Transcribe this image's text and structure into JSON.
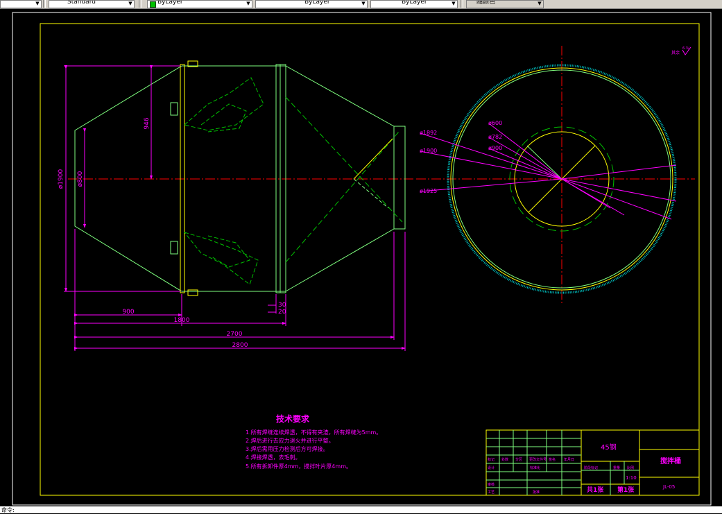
{
  "toolbar": {
    "style_value": "Standard",
    "color_value": "ByLayer",
    "linetype_value": "ByLayer",
    "lineweight_value": "ByLayer",
    "plotstyle_value": "随颜色"
  },
  "drawing": {
    "dims_front": {
      "d1900": "ø1900",
      "d800": "ø800",
      "h946": "946",
      "w900": "900",
      "w1800": "1800",
      "w2700": "2700",
      "w2800": "2800",
      "t30": "30",
      "t20": "20"
    },
    "dims_side": {
      "d600": "ø600",
      "d782": "ø782",
      "d900": "ø900",
      "d1892": "ø1892",
      "d1900": "ø1900",
      "d1925": "ø1925"
    },
    "surface_symbol": "6.3/",
    "surface_label": "其余"
  },
  "tech_req": {
    "title": "技术要求",
    "items": [
      "1.所有焊缝连续焊透，不得有夹渣，所有焊缝为5mm。",
      "2.焊后进行去应力退火并进行平整。",
      "3.焊后需用压力检测后方可焊接。",
      "4.焊接焊透，去毛刺。",
      "5.所有拆卸件厚4mm，搅拌叶片厚4mm。"
    ]
  },
  "title_block": {
    "material": "45钢",
    "part_name": "搅拌桶",
    "drawing_no": "JL-05",
    "scale": "1:10",
    "sheet_total": "共1张",
    "sheet_no": "第1张",
    "row_labels": [
      "标记",
      "处数",
      "分区",
      "更改文件号",
      "签名",
      "年月日"
    ],
    "design": "设计",
    "standardize": "标准化",
    "review": "审核",
    "process": "工艺",
    "approve": "批准",
    "stage_mark": "阶段标记",
    "weight": "重量",
    "ratio": "比例"
  },
  "command": {
    "prompt": "命令:"
  },
  "colors": {
    "outline": "#ffff00",
    "body": "#7fff7f",
    "dim": "#ff00ff",
    "center": "#ff0000",
    "hidden": "#00c000",
    "teeth": "#00c0c0"
  }
}
